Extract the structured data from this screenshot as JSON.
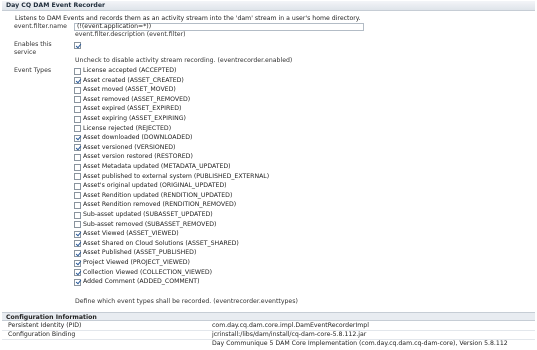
{
  "title": "Day CQ DAM Event Recorder",
  "description": "Listens to DAM Events and records them as an activity stream into the 'dam' stream in a user's home directory.",
  "filter": {
    "label": "event.filter.name",
    "value": "(!(event.application=*))",
    "note": "event.filter.description (event.filter)"
  },
  "enable": {
    "label": "Enables this service",
    "checked": true,
    "note": "Uncheck to disable activity stream recording. (eventrecorder.enabled)"
  },
  "event_types": {
    "label": "Event Types",
    "note": "Define which event types shall be recorded. (eventrecorder.eventtypes)",
    "items": [
      {
        "label": "License accepted (ACCEPTED)",
        "checked": false
      },
      {
        "label": "Asset created (ASSET_CREATED)",
        "checked": true
      },
      {
        "label": "Asset moved (ASSET_MOVED)",
        "checked": false
      },
      {
        "label": "Asset removed (ASSET_REMOVED)",
        "checked": false
      },
      {
        "label": "Asset expired (ASSET_EXPIRED)",
        "checked": false
      },
      {
        "label": "Asset expiring (ASSET_EXPIRING)",
        "checked": false
      },
      {
        "label": "License rejected (REJECTED)",
        "checked": false
      },
      {
        "label": "Asset downloaded (DOWNLOADED)",
        "checked": true
      },
      {
        "label": "Asset versioned (VERSIONED)",
        "checked": true
      },
      {
        "label": "Asset version restored (RESTORED)",
        "checked": false
      },
      {
        "label": "Asset Metadata updated (METADATA_UPDATED)",
        "checked": false
      },
      {
        "label": "Asset published to external system (PUBLISHED_EXTERNAL)",
        "checked": false
      },
      {
        "label": "Asset's original updated (ORIGINAL_UPDATED)",
        "checked": false
      },
      {
        "label": "Asset Rendition updated (RENDITION_UPDATED)",
        "checked": false
      },
      {
        "label": "Asset Rendition removed (RENDITION_REMOVED)",
        "checked": false
      },
      {
        "label": "Sub-asset updated (SUBASSET_UPDATED)",
        "checked": false
      },
      {
        "label": "Sub-asset removed (SUBASSET_REMOVED)",
        "checked": false
      },
      {
        "label": "Asset Viewed (ASSET_VIEWED)",
        "checked": true
      },
      {
        "label": "Asset Shared on Cloud Solutions (ASSET_SHARED)",
        "checked": true
      },
      {
        "label": "Asset Published (ASSET_PUBLISHED)",
        "checked": true
      },
      {
        "label": "Project Viewed (PROJECT_VIEWED)",
        "checked": true
      },
      {
        "label": "Collection Viewed (COLLECTION_VIEWED)",
        "checked": true
      },
      {
        "label": "Added Comment (ADDED_COMMENT)",
        "checked": true
      }
    ]
  },
  "config": {
    "title": "Configuration Information",
    "pid_label": "Persistent Identity (PID)",
    "pid_value": "com.day.cq.dam.core.impl.DamEventRecorderImpl",
    "binding_label": "Configuration Binding",
    "binding_value": "jcrinstall:/libs/dam/install/cq-dam-core-5.8.112.jar",
    "bundle_value": "Day Communique 5 DAM Core Implementation (com.day.cq.dam.cq-dam-core), Version 5.8.112"
  }
}
